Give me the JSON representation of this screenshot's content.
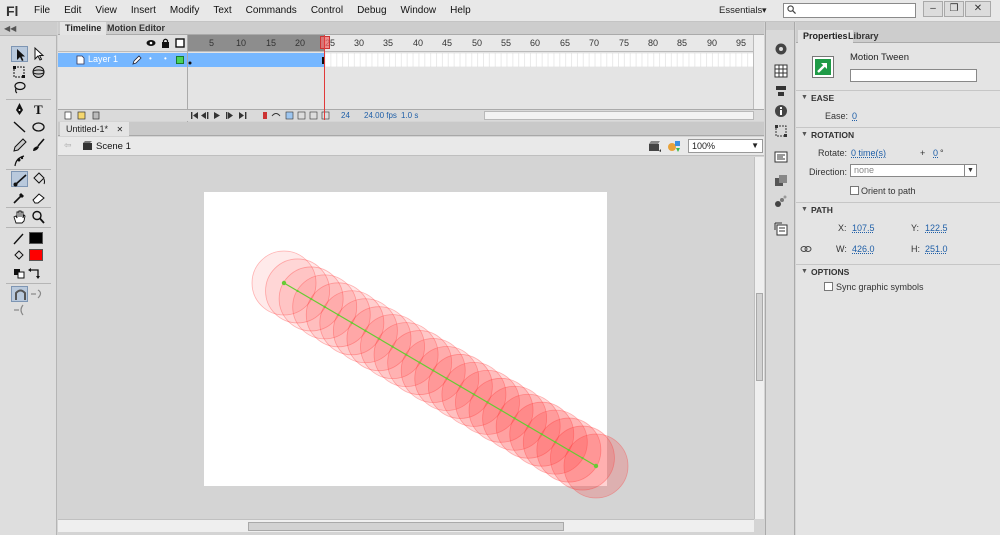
{
  "app": {
    "logo": "Fl",
    "menu": [
      "File",
      "Edit",
      "View",
      "Insert",
      "Modify",
      "Text",
      "Commands",
      "Control",
      "Debug",
      "Window",
      "Help"
    ],
    "workspace": "Essentials",
    "search_placeholder": ""
  },
  "timeline": {
    "tabs": [
      "Timeline",
      "Motion Editor"
    ],
    "ruler_numbers": [
      "5",
      "10",
      "15",
      "20",
      "25",
      "30",
      "35",
      "40",
      "45",
      "50",
      "55",
      "60",
      "65",
      "70",
      "75",
      "80",
      "85",
      "90",
      "95"
    ],
    "layer_name": "Layer 1",
    "current_frame": "24",
    "fps": "24.00 fps",
    "elapsed": "1.0 s"
  },
  "document": {
    "tab_label": "Untitled-1*",
    "scene": "Scene 1",
    "zoom": "100%"
  },
  "properties": {
    "tabs": [
      "Properties",
      "Library"
    ],
    "instance_type": "Motion Tween",
    "sections": {
      "ease": "EASE",
      "rotation": "ROTATION",
      "path": "PATH",
      "options": "OPTIONS"
    },
    "ease_label": "Ease:",
    "ease_value": "0",
    "rotate_label": "Rotate:",
    "rotate_times": "0 time(s)",
    "rotate_plus": "+",
    "rotate_degrees": "0",
    "degree_symbol": "°",
    "direction_label": "Direction:",
    "direction_value": "none",
    "orient_label": "Orient to path",
    "x_label": "X:",
    "x_value": "107.5",
    "y_label": "Y:",
    "y_value": "122.5",
    "w_label": "W:",
    "w_value": "426.0",
    "h_label": "H:",
    "h_value": "251.0",
    "sync_label": "Sync graphic symbols"
  },
  "colors": {
    "stroke": "#000000",
    "fill": "#ff0000",
    "tween_circle": "#ff3333",
    "motion_path": "#66cc33",
    "layer_highlight": "#76b7ff",
    "playhead": "#e03a3a"
  }
}
